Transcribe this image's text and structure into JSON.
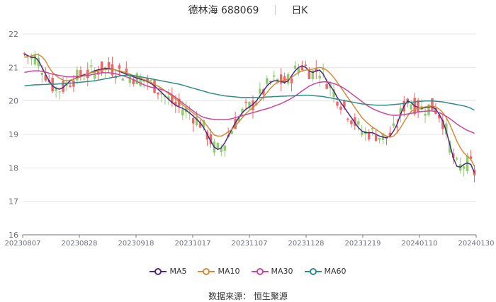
{
  "header": {
    "title": "德林海 688069",
    "period": "日K"
  },
  "source": "数据来源： 恒生聚源",
  "colors": {
    "up": "#ee6666",
    "down": "#91cc75",
    "grid": "#e5e5e5",
    "axis": "#6e7079"
  },
  "chart_data": {
    "type": "candlestick",
    "ylim": [
      16,
      22
    ],
    "yticks": [
      "16",
      "17",
      "18",
      "19",
      "20",
      "21",
      "22"
    ],
    "xticks": [
      "20230807",
      "20230828",
      "20230918",
      "20231017",
      "20231107",
      "20231128",
      "20231219",
      "20240110",
      "20240130"
    ],
    "series": [
      {
        "name": "MA5",
        "color": "#4b2c7b",
        "values": [
          21.4,
          21.35,
          21.3,
          21.3,
          21.2,
          21.0,
          20.8,
          20.6,
          20.45,
          20.38,
          20.35,
          20.4,
          20.5,
          20.6,
          20.65,
          20.7,
          20.75,
          20.78,
          20.8,
          20.85,
          20.9,
          20.93,
          20.95,
          20.97,
          20.97,
          20.95,
          20.92,
          20.88,
          20.84,
          20.8,
          20.76,
          20.72,
          20.68,
          20.65,
          20.62,
          20.58,
          20.52,
          20.45,
          20.35,
          20.25,
          20.15,
          20.05,
          19.95,
          19.87,
          19.82,
          19.78,
          19.72,
          19.64,
          19.55,
          19.45,
          19.35,
          19.2,
          19.0,
          18.8,
          18.62,
          18.55,
          18.6,
          18.75,
          18.95,
          19.15,
          19.35,
          19.5,
          19.65,
          19.75,
          19.82,
          19.9,
          20.0,
          20.15,
          20.3,
          20.45,
          20.55,
          20.6,
          20.6,
          20.58,
          20.55,
          20.6,
          20.75,
          20.9,
          21.0,
          21.05,
          21.0,
          20.9,
          20.85,
          20.9,
          20.92,
          20.8,
          20.6,
          20.45,
          20.3,
          20.1,
          19.95,
          19.8,
          19.65,
          19.5,
          19.35,
          19.2,
          19.1,
          19.05,
          19.05,
          19.05,
          19.0,
          18.95,
          18.92,
          18.9,
          18.95,
          19.1,
          19.3,
          19.6,
          19.85,
          20.0,
          19.95,
          19.85,
          19.8,
          19.78,
          19.8,
          19.82,
          19.83,
          19.75,
          19.6,
          19.4,
          19.1,
          18.7,
          18.3,
          18.05,
          18.02,
          18.1,
          18.15,
          18.1,
          17.85
        ]
      },
      {
        "name": "MA10",
        "color": "#d48a38",
        "values": [
          21.3,
          21.32,
          21.35,
          21.38,
          21.38,
          21.32,
          21.2,
          21.0,
          20.85,
          20.75,
          20.68,
          20.62,
          20.6,
          20.62,
          20.65,
          20.68,
          20.72,
          20.76,
          20.8,
          20.84,
          20.87,
          20.9,
          20.92,
          20.94,
          20.95,
          20.94,
          20.92,
          20.9,
          20.87,
          20.84,
          20.8,
          20.76,
          20.72,
          20.68,
          20.64,
          20.6,
          20.55,
          20.5,
          20.44,
          20.38,
          20.3,
          20.22,
          20.14,
          20.05,
          19.97,
          19.88,
          19.8,
          19.72,
          19.64,
          19.56,
          19.48,
          19.38,
          19.25,
          19.1,
          18.98,
          18.95,
          18.95,
          19.0,
          19.08,
          19.15,
          19.25,
          19.38,
          19.5,
          19.62,
          19.72,
          19.8,
          19.9,
          20.0,
          20.12,
          20.25,
          20.38,
          20.48,
          20.55,
          20.6,
          20.62,
          20.65,
          20.7,
          20.78,
          20.85,
          20.9,
          20.92,
          20.93,
          20.95,
          20.98,
          21.0,
          20.98,
          20.92,
          20.82,
          20.7,
          20.55,
          20.4,
          20.25,
          20.1,
          19.95,
          19.8,
          19.65,
          19.5,
          19.4,
          19.3,
          19.22,
          19.15,
          19.08,
          19.0,
          18.95,
          18.92,
          18.95,
          19.05,
          19.2,
          19.38,
          19.55,
          19.68,
          19.75,
          19.78,
          19.8,
          19.82,
          19.84,
          19.85,
          19.82,
          19.75,
          19.65,
          19.5,
          19.3,
          19.05,
          18.8,
          18.6,
          18.45,
          18.35,
          18.25,
          18.05
        ]
      },
      {
        "name": "MA30",
        "color": "#c8479c",
        "values": [
          20.85,
          20.87,
          20.89,
          20.9,
          20.9,
          20.88,
          20.86,
          20.83,
          20.8,
          20.78,
          20.76,
          20.74,
          20.72,
          20.72,
          20.72,
          20.73,
          20.74,
          20.75,
          20.76,
          20.78,
          20.8,
          20.82,
          20.84,
          20.84,
          20.84,
          20.83,
          20.81,
          20.78,
          20.75,
          20.72,
          20.68,
          20.63,
          20.58,
          20.53,
          20.48,
          20.44,
          20.41,
          20.39,
          20.37,
          20.34,
          20.3,
          20.25,
          20.18,
          20.1,
          20.02,
          19.94,
          19.86,
          19.78,
          19.7,
          19.62,
          19.56,
          19.51,
          19.48,
          19.46,
          19.45,
          19.44,
          19.44,
          19.44,
          19.45,
          19.47,
          19.5,
          19.53,
          19.56,
          19.59,
          19.62,
          19.65,
          19.68,
          19.71,
          19.74,
          19.77,
          19.8,
          19.84,
          19.88,
          19.92,
          19.97,
          20.02,
          20.08,
          20.15,
          20.22,
          20.3,
          20.37,
          20.44,
          20.49,
          20.53,
          20.56,
          20.57,
          20.57,
          20.55,
          20.52,
          20.48,
          20.43,
          20.37,
          20.3,
          20.22,
          20.14,
          20.06,
          19.98,
          19.9,
          19.83,
          19.77,
          19.72,
          19.68,
          19.64,
          19.61,
          19.58,
          19.57,
          19.57,
          19.58,
          19.59,
          19.61,
          19.63,
          19.65,
          19.67,
          19.68,
          19.69,
          19.7,
          19.7,
          19.68,
          19.65,
          19.6,
          19.54,
          19.47,
          19.39,
          19.31,
          19.24,
          19.18,
          19.12,
          19.08,
          19.03
        ]
      },
      {
        "name": "MA60",
        "color": "#2f8c88",
        "values": [
          20.45,
          20.46,
          20.47,
          20.48,
          20.48,
          20.49,
          20.49,
          20.5,
          20.5,
          20.5,
          20.51,
          20.51,
          20.52,
          20.53,
          20.54,
          20.55,
          20.56,
          20.57,
          20.58,
          20.59,
          20.6,
          20.62,
          20.64,
          20.66,
          20.68,
          20.7,
          20.72,
          20.74,
          20.76,
          20.77,
          20.77,
          20.76,
          20.74,
          20.72,
          20.7,
          20.68,
          20.66,
          20.64,
          20.62,
          20.6,
          20.58,
          20.56,
          20.54,
          20.52,
          20.5,
          20.47,
          20.44,
          20.41,
          20.38,
          20.35,
          20.32,
          20.29,
          20.26,
          20.23,
          20.21,
          20.19,
          20.17,
          20.15,
          20.14,
          20.13,
          20.12,
          20.11,
          20.1,
          20.1,
          20.1,
          20.1,
          20.1,
          20.1,
          20.11,
          20.12,
          20.12,
          20.13,
          20.13,
          20.14,
          20.14,
          20.15,
          20.15,
          20.16,
          20.16,
          20.17,
          20.17,
          20.17,
          20.16,
          20.15,
          20.14,
          20.13,
          20.11,
          20.09,
          20.07,
          20.05,
          20.03,
          20.01,
          19.99,
          19.97,
          19.95,
          19.93,
          19.91,
          19.9,
          19.89,
          19.88,
          19.87,
          19.87,
          19.87,
          19.87,
          19.88,
          19.89,
          19.9,
          19.91,
          19.93,
          19.95,
          19.96,
          19.97,
          19.98,
          19.99,
          20.0,
          20.0,
          20.0,
          19.99,
          19.98,
          19.97,
          19.95,
          19.93,
          19.91,
          19.89,
          19.87,
          19.85,
          19.82,
          19.78,
          19.72
        ]
      }
    ]
  }
}
